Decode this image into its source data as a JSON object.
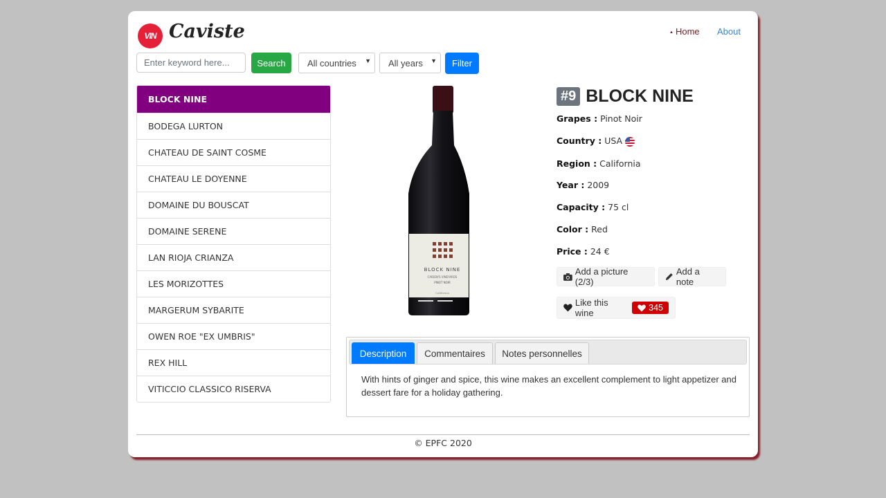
{
  "header": {
    "logo_text": "VIN",
    "brand": "Caviste",
    "nav": {
      "home": "Home",
      "about": "About"
    }
  },
  "toolbar": {
    "search_placeholder": "Enter keyword here...",
    "search_label": "Search",
    "country_select": "All countries",
    "year_select": "All years",
    "filter_label": "Filter"
  },
  "wine_list": [
    "BLOCK NINE",
    "BODEGA LURTON",
    "CHATEAU DE SAINT COSME",
    "CHATEAU LE DOYENNE",
    "DOMAINE DU BOUSCAT",
    "DOMAINE SERENE",
    "LAN RIOJA CRIANZA",
    "LES MORIZOTTES",
    "MARGERUM SYBARITE",
    "OWEN ROE \"EX UMBRIS\"",
    "REX HILL",
    "VITICCIO CLASSICO RISERVA"
  ],
  "selected_index": 0,
  "detail": {
    "badge": "#9",
    "name": "BLOCK NINE",
    "fields": [
      {
        "label": "Grapes :",
        "value": "Pinot Noir"
      },
      {
        "label": "Country :",
        "value": "USA"
      },
      {
        "label": "Region :",
        "value": "California"
      },
      {
        "label": "Year :",
        "value": "2009"
      },
      {
        "label": "Capacity :",
        "value": "75 cl"
      },
      {
        "label": "Color :",
        "value": "Red"
      },
      {
        "label": "Price :",
        "value": "24 €"
      }
    ],
    "add_picture": "Add a picture (2/3)",
    "add_note": "Add a note",
    "like": "Like this wine",
    "like_count": "345",
    "bottle_label": {
      "brand": "BLOCK NINE",
      "vineyard": "CAIDEN'S VINEYARDS",
      "grape": "PINOT NOIR",
      "region": "California"
    }
  },
  "tabs": {
    "items": [
      "Description",
      "Commentaires",
      "Notes personnelles"
    ],
    "active": 0,
    "description": "With hints of ginger and spice, this wine makes an excellent complement to light appetizer and dessert fare for a holiday gathering."
  },
  "footer": "© EPFC 2020",
  "colors": {
    "active_item": "#800080",
    "like_badge": "#d00000",
    "card_shadow": "#8a1f2b"
  }
}
